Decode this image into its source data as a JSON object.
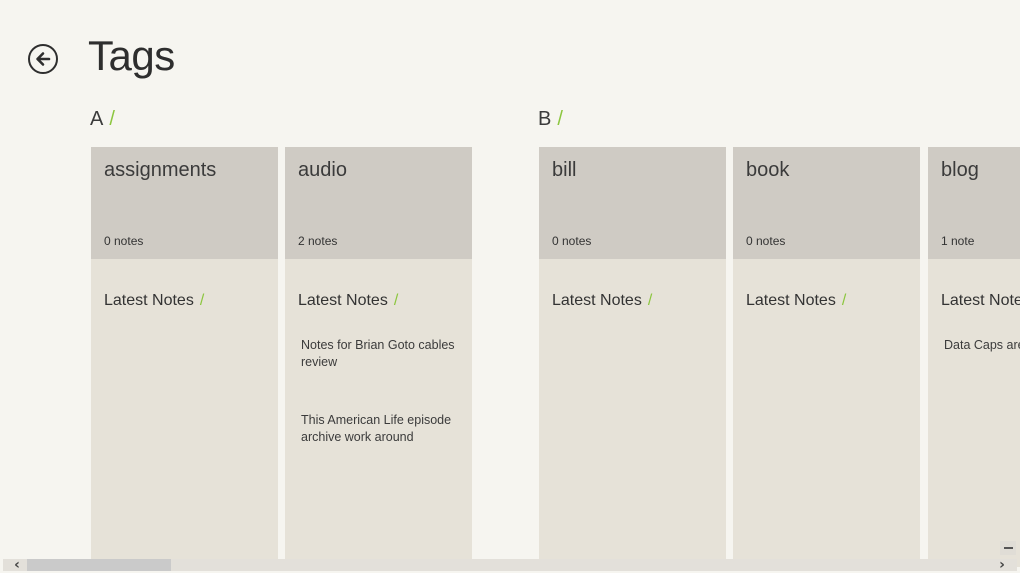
{
  "header": {
    "title": "Tags",
    "back_icon": "arrow-left-circle-icon"
  },
  "accent_color": "#8cc63f",
  "groups": [
    {
      "letter": "A",
      "separator": "/",
      "tags": [
        {
          "name": "assignments",
          "count": "0 notes",
          "latest_label": "Latest Notes",
          "notes": []
        },
        {
          "name": "audio",
          "count": "2 notes",
          "latest_label": "Latest Notes",
          "notes": [
            "Notes for Brian Goto cables review",
            "This American Life episode archive work around"
          ]
        }
      ]
    },
    {
      "letter": "B",
      "separator": "/",
      "tags": [
        {
          "name": "bill",
          "count": "0 notes",
          "latest_label": "Latest Notes",
          "notes": []
        },
        {
          "name": "book",
          "count": "0 notes",
          "latest_label": "Latest Notes",
          "notes": []
        },
        {
          "name": "blog",
          "count": "1 note",
          "latest_label": "Latest Notes",
          "notes": [
            "Data Caps are"
          ]
        }
      ]
    }
  ],
  "scrollbar": {
    "left_arrow": "‹",
    "right_arrow": "›",
    "zoom_label": "−"
  }
}
